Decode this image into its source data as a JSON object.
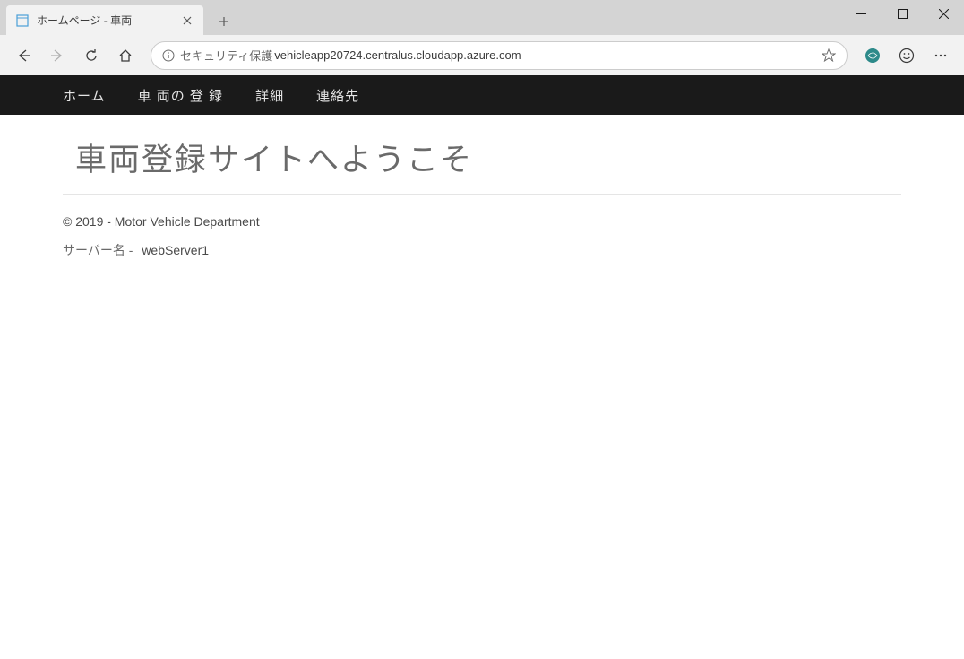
{
  "browser": {
    "tab_title": "ホームページ - 車両",
    "security_label": "セキュリティ保護",
    "url": "vehicleapp20724.centralus.cloudapp.azure.com"
  },
  "nav": {
    "items": [
      "ホーム",
      "車 両の 登 録",
      "詳細",
      "連絡先"
    ]
  },
  "page": {
    "heading": "車両登録サイトへようこそ",
    "copyright": "© 2019 - Motor Vehicle Department",
    "server_label": "サーバー名 -",
    "server_name": "webServer1"
  }
}
